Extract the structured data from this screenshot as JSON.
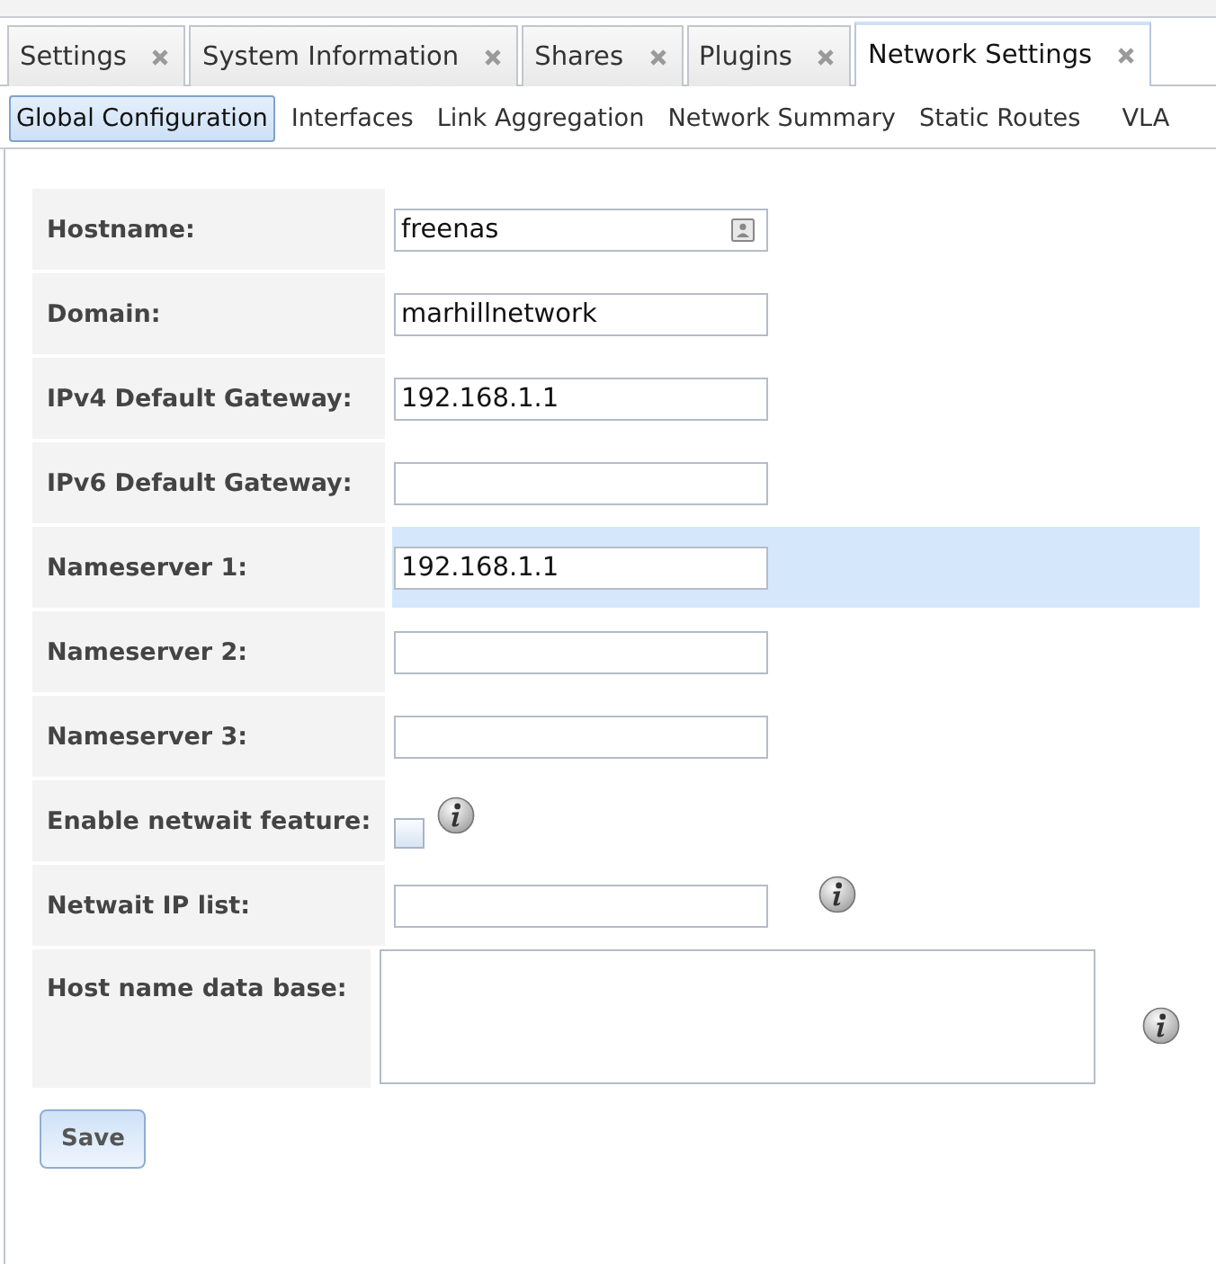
{
  "tabs": [
    {
      "label": "Settings",
      "selected": false
    },
    {
      "label": "System Information",
      "selected": false
    },
    {
      "label": "Shares",
      "selected": false
    },
    {
      "label": "Plugins",
      "selected": false
    },
    {
      "label": "Network Settings",
      "selected": true
    }
  ],
  "subtabs": [
    {
      "label": "Global Configuration",
      "selected": true
    },
    {
      "label": "Interfaces",
      "selected": false
    },
    {
      "label": "Link Aggregation",
      "selected": false
    },
    {
      "label": "Network Summary",
      "selected": false
    },
    {
      "label": "Static Routes",
      "selected": false
    },
    {
      "label": "VLA",
      "selected": false
    }
  ],
  "form": [
    {
      "label": "Hostname:",
      "kind": "text",
      "value": "freenas",
      "highlighted": false,
      "info": false,
      "contact_button": true
    },
    {
      "label": "Domain:",
      "kind": "text",
      "value": "marhillnetwork",
      "highlighted": false,
      "info": false
    },
    {
      "label": "IPv4 Default Gateway:",
      "kind": "text",
      "value": "192.168.1.1",
      "highlighted": false,
      "info": false
    },
    {
      "label": "IPv6 Default Gateway:",
      "kind": "text",
      "highlighted": false,
      "info": false
    },
    {
      "label": "Nameserver 1:",
      "kind": "text",
      "value": "192.168.1.1",
      "highlighted": true,
      "info": false
    },
    {
      "label": "Nameserver 2:",
      "kind": "text",
      "highlighted": false,
      "info": false
    },
    {
      "label": "Nameserver 3:",
      "kind": "text",
      "highlighted": false,
      "info": false
    },
    {
      "label": "Enable netwait feature:",
      "kind": "checkbox",
      "checked": false,
      "highlighted": false,
      "info": true
    },
    {
      "label": "Netwait IP list:",
      "kind": "text",
      "highlighted": false,
      "info": true
    },
    {
      "label": "Host name data base:",
      "kind": "textarea",
      "highlighted": false,
      "info": true
    }
  ],
  "save_button": "Save"
}
